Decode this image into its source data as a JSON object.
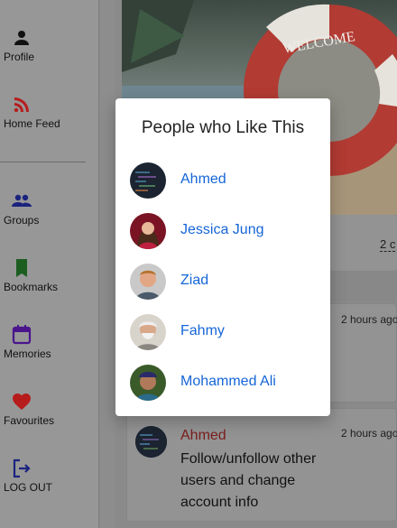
{
  "sidebar": {
    "items": [
      {
        "label": "Profile",
        "icon": "person-icon",
        "color": "#111111"
      },
      {
        "label": "Home Feed",
        "icon": "rss-icon",
        "color": "#b71c1c"
      },
      {
        "label": "Groups",
        "icon": "groups-icon",
        "color": "#1a237e"
      },
      {
        "label": "Bookmarks",
        "icon": "bookmark-icon",
        "color": "#1b5e20"
      },
      {
        "label": "Memories",
        "icon": "calendar-icon",
        "color": "#4a148c"
      },
      {
        "label": "Favourites",
        "icon": "heart-icon",
        "color": "#b71c1c"
      },
      {
        "label": "LOG OUT",
        "icon": "logout-icon",
        "color": "#1a237e"
      }
    ]
  },
  "feed": {
    "photo_sign_text": "WELCOME",
    "comment_count": "2 c",
    "post1": {
      "time": "2 hours ago"
    },
    "post2": {
      "author": "Ahmed",
      "time": "2 hours ago",
      "text": "Follow/unfollow other users and change account info"
    }
  },
  "likes_modal": {
    "title": "People who Like This",
    "people": [
      {
        "name": "Ahmed",
        "avatar": "code-screen-avatar"
      },
      {
        "name": "Jessica Jung",
        "avatar": "woman-avatar"
      },
      {
        "name": "Ziad",
        "avatar": "man-avatar"
      },
      {
        "name": "Fahmy",
        "avatar": "elder-avatar"
      },
      {
        "name": "Mohammed Ali",
        "avatar": "man-cap-avatar"
      }
    ]
  },
  "colors": {
    "link": "#1565d8",
    "author": "#7a1d1d"
  }
}
